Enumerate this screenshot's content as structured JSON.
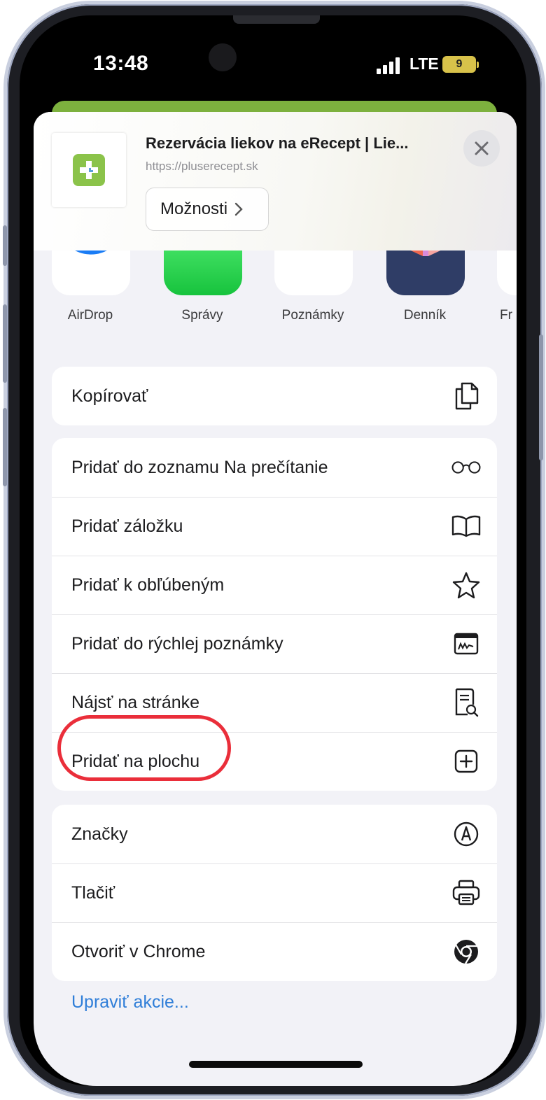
{
  "status_bar": {
    "time": "13:48",
    "network": "LTE",
    "battery": "9"
  },
  "share_header": {
    "title": "Rezervácia liekov na eRecept | Lie...",
    "url": "https://pluserecept.sk",
    "options_label": "Možnosti"
  },
  "apps": [
    {
      "label": "AirDrop"
    },
    {
      "label": "Správy"
    },
    {
      "label": "Poznámky"
    },
    {
      "label": "Denník"
    },
    {
      "label": "Fr"
    }
  ],
  "actions": {
    "group1": [
      {
        "label": "Kopírovať",
        "icon": "copy-icon"
      }
    ],
    "group2": [
      {
        "label": "Pridať do zoznamu Na prečítanie",
        "icon": "glasses-icon"
      },
      {
        "label": "Pridať záložku",
        "icon": "book-icon"
      },
      {
        "label": "Pridať k obľúbeným",
        "icon": "star-icon"
      },
      {
        "label": "Pridať do rýchlej poznámky",
        "icon": "quick-note-icon"
      },
      {
        "label": "Nájsť na stránke",
        "icon": "find-on-page-icon"
      },
      {
        "label": "Pridať na plochu",
        "icon": "add-square-icon"
      }
    ],
    "group3": [
      {
        "label": "Značky",
        "icon": "markup-icon"
      },
      {
        "label": "Tlačiť",
        "icon": "printer-icon"
      },
      {
        "label": "Otvoriť v Chrome",
        "icon": "chrome-icon"
      }
    ]
  },
  "edit_actions_label": "Upraviť akcie...",
  "colors": {
    "accent_link": "#2f7ed8",
    "highlight_ring": "#ea2e3a",
    "site_green": "#7db13e",
    "logo_green": "#8bc34a"
  }
}
